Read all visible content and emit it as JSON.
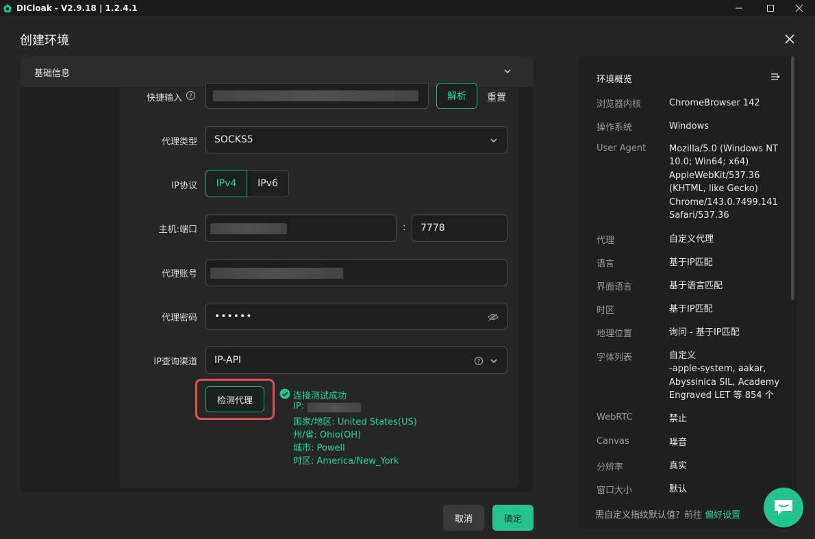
{
  "window": {
    "title": "DICloak - V2.9.18 | 1.2.4.1"
  },
  "dialog": {
    "title": "创建环境",
    "section": {
      "title": "基础信息"
    },
    "form": {
      "quick_input": {
        "label": "快捷输入",
        "parse_label": "解析",
        "reset_label": "重置"
      },
      "proxy_type": {
        "label": "代理类型",
        "value": "SOCKS5"
      },
      "ip_protocol": {
        "label": "IP协议",
        "options": [
          "IPv4",
          "IPv6"
        ],
        "selected": "IPv4"
      },
      "host_port": {
        "label": "主机:端口",
        "separator": ":",
        "port": "7778"
      },
      "proxy_account": {
        "label": "代理账号"
      },
      "proxy_password": {
        "label": "代理密码",
        "value": "••••••"
      },
      "ip_channel": {
        "label": "IP查询渠道",
        "value": "IP-API"
      },
      "check_button": "检测代理",
      "result": {
        "title": "连接测试成功",
        "ip_label": "IP:",
        "country": "国家/地区: United States(US)",
        "state": "州/省: Ohio(OH)",
        "city": "城市: Powell",
        "timezone": "时区: America/New_York"
      }
    },
    "footer": {
      "cancel": "取消",
      "confirm": "确定"
    }
  },
  "overview": {
    "title": "环境概览",
    "rows": [
      {
        "key": "浏览器内核",
        "value": "ChromeBrowser 142"
      },
      {
        "key": "操作系统",
        "value": "Windows"
      },
      {
        "key": "User Agent",
        "value": "Mozilla/5.0 (Windows NT 10.0; Win64; x64) AppleWebKit/537.36 (KHTML, like Gecko) Chrome/143.0.7499.141 Safari/537.36"
      },
      {
        "key": "代理",
        "value": "自定义代理"
      },
      {
        "key": "语言",
        "value": "基于IP匹配"
      },
      {
        "key": "界面语言",
        "value": "基于语言匹配"
      },
      {
        "key": "时区",
        "value": "基于IP匹配"
      },
      {
        "key": "地理位置",
        "value": "询问 - 基于IP匹配"
      },
      {
        "key": "字体列表",
        "value": "自定义\n-apple-system, aakar, Abyssinica SIL, Academy Engraved LET 等 854 个"
      },
      {
        "key": "WebRTC",
        "value": "禁止"
      },
      {
        "key": "Canvas",
        "value": "噪音"
      },
      {
        "key": "分辨率",
        "value": "真实"
      },
      {
        "key": "窗口大小",
        "value": "默认"
      }
    ],
    "footer_text": "需自定义指纹默认值？前往",
    "footer_link": "偏好设置"
  },
  "colors": {
    "accent": "#25c38f",
    "accent_text": "#27d6a3",
    "highlight": "#e05353",
    "background": "#252525"
  }
}
